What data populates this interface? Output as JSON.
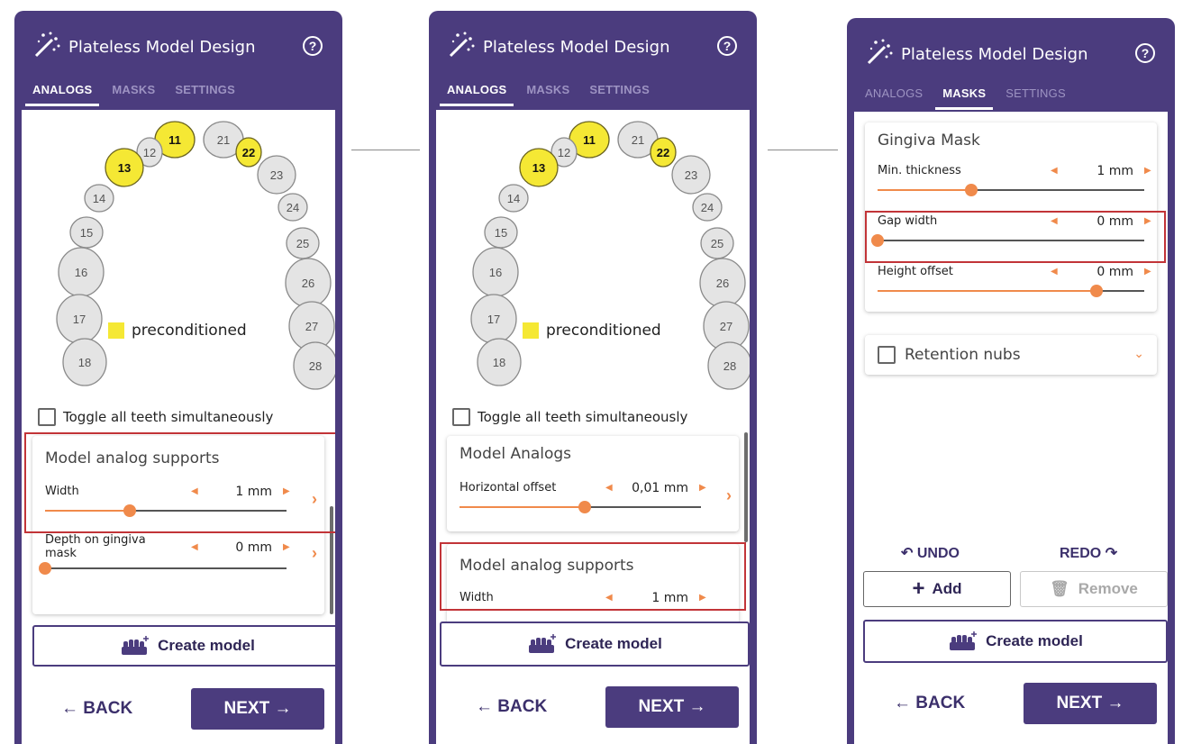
{
  "colors": {
    "purple": "#4b3c7e",
    "accent": "#f08a4b",
    "preconditioned": "#f5e834",
    "highlight": "#c23438"
  },
  "panels": [
    {
      "title": "Plateless Model Design",
      "tabs": [
        "ANALOGS",
        "MASKS",
        "SETTINGS"
      ],
      "active_tab": "ANALOGS",
      "legend": "preconditioned",
      "toggle_all": "Toggle all teeth simultaneously",
      "card1": {
        "title": "Model analog supports",
        "width_label": "Width",
        "width_value": "1 mm",
        "depth_label": "Depth on gingiva mask",
        "depth_value": "0 mm"
      },
      "create_model": "Create model",
      "back": "BACK",
      "next": "NEXT"
    },
    {
      "title": "Plateless Model Design",
      "tabs": [
        "ANALOGS",
        "MASKS",
        "SETTINGS"
      ],
      "active_tab": "ANALOGS",
      "legend": "preconditioned",
      "toggle_all": "Toggle all teeth simultaneously",
      "card1": {
        "title": "Model Analogs",
        "offset_label": "Horizontal offset",
        "offset_value": "0,01 mm"
      },
      "card2": {
        "title": "Model analog supports",
        "width_label": "Width",
        "width_value": "1 mm"
      },
      "create_model": "Create model",
      "back": "BACK",
      "next": "NEXT"
    },
    {
      "title": "Plateless Model Design",
      "tabs": [
        "ANALOGS",
        "MASKS",
        "SETTINGS"
      ],
      "active_tab": "MASKS",
      "gingiva": {
        "title": "Gingiva Mask",
        "min_label": "Min. thickness",
        "min_value": "1 mm",
        "gap_label": "Gap width",
        "gap_value": "0 mm",
        "height_label": "Height offset",
        "height_value": "0 mm"
      },
      "retention": "Retention nubs",
      "undo": "UNDO",
      "redo": "REDO",
      "add": "Add",
      "remove": "Remove",
      "create_model": "Create model",
      "back": "BACK",
      "next": "NEXT"
    }
  ],
  "teeth": {
    "upper_right": [
      "11",
      "12",
      "13",
      "14",
      "15",
      "16",
      "17",
      "18"
    ],
    "upper_left": [
      "21",
      "22",
      "23",
      "24",
      "25",
      "26",
      "27",
      "28"
    ],
    "preconditioned": [
      "11",
      "13",
      "22"
    ]
  },
  "sliders": {
    "p1_width": 0.35,
    "p1_depth": 0.0,
    "p2_offset": 0.52,
    "p3_min": 0.35,
    "p3_gap": 0.0,
    "p3_height": 0.82
  }
}
